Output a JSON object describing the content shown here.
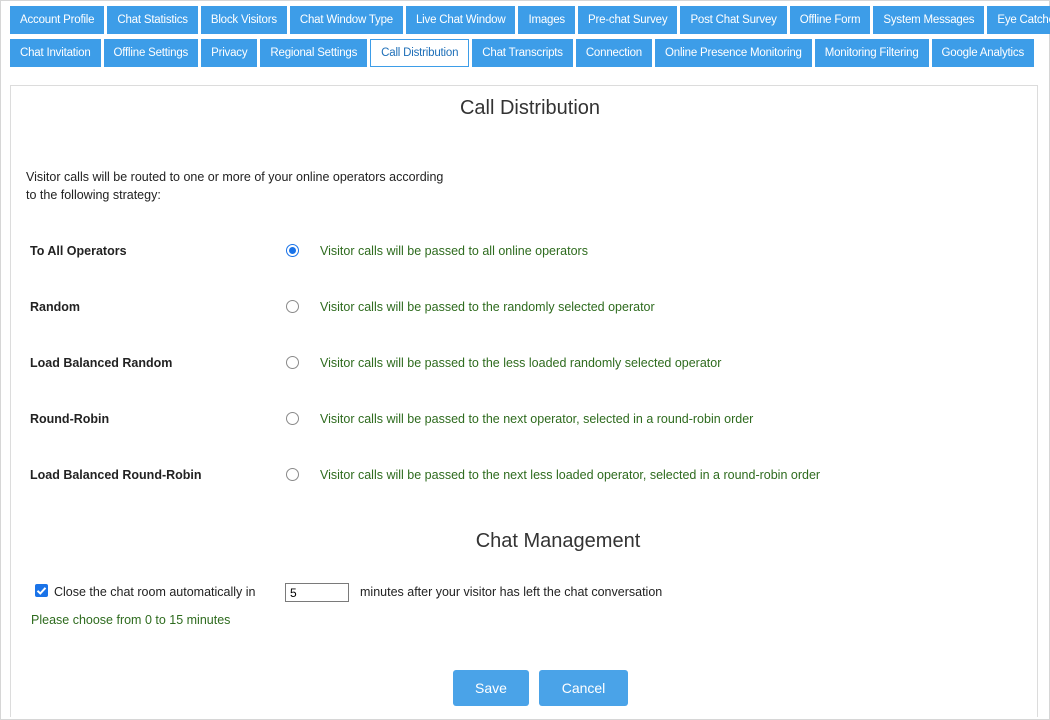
{
  "tabs_row1": [
    "Account Profile",
    "Chat Statistics",
    "Block Visitors",
    "Chat Window Type",
    "Live Chat Window",
    "Images",
    "Pre-chat Survey",
    "Post Chat Survey",
    "Offline Form",
    "System Messages",
    "Eye Catcher"
  ],
  "tabs_row2": [
    "Chat Invitation",
    "Offline Settings",
    "Privacy",
    "Regional Settings",
    "Call Distribution",
    "Chat Transcripts",
    "Connection",
    "Online Presence Monitoring",
    "Monitoring Filtering",
    "Google Analytics"
  ],
  "active_tab": "Call Distribution",
  "section_title": "Call Distribution",
  "intro_text": "Visitor calls will be routed to one or more of your online operators according to the following strategy:",
  "strategies": [
    {
      "label": "To All Operators",
      "description": "Visitor calls will be passed to all online operators",
      "checked": true
    },
    {
      "label": "Random",
      "description": "Visitor calls will be passed to the randomly selected operator",
      "checked": false
    },
    {
      "label": "Load Balanced Random",
      "description": "Visitor calls will be passed to the less loaded randomly selected operator",
      "checked": false
    },
    {
      "label": "Round-Robin",
      "description": "Visitor calls will be passed to the next operator, selected in a round-robin order",
      "checked": false
    },
    {
      "label": "Load Balanced Round-Robin",
      "description": "Visitor calls will be passed to the next less loaded operator, selected in a round-robin order",
      "checked": false
    }
  ],
  "chat_management": {
    "title": "Chat Management",
    "auto_close_checked": true,
    "auto_close_prefix": "Close the chat room automatically in",
    "minutes_value": "5",
    "auto_close_suffix": "minutes after your visitor has left the chat conversation",
    "hint": "Please choose from 0 to 15 minutes"
  },
  "buttons": {
    "save": "Save",
    "cancel": "Cancel"
  },
  "colors": {
    "tab_bg": "#3d9de8",
    "accent": "#1a73e8",
    "hint_green": "#2e6b1e"
  }
}
